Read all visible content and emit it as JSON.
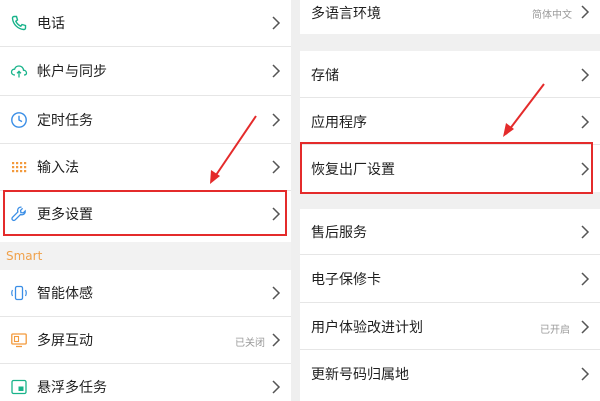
{
  "left_panel": {
    "items": [
      {
        "label": "电话",
        "icon": "phone-icon"
      },
      {
        "label": "帐户与同步",
        "icon": "cloud-sync-icon"
      },
      {
        "label": "定时任务",
        "icon": "clock-icon"
      },
      {
        "label": "输入法",
        "icon": "keyboard-icon"
      },
      {
        "label": "更多设置",
        "icon": "wrench-icon"
      }
    ],
    "smart_section_title": "Smart",
    "smart_items": [
      {
        "label": "智能体感",
        "icon": "phone-gesture-icon"
      },
      {
        "label": "多屏互动",
        "icon": "multi-screen-icon",
        "value": "已关闭"
      },
      {
        "label": "悬浮多任务",
        "icon": "floating-window-icon"
      }
    ]
  },
  "right_panel": {
    "items": [
      {
        "label": "多语言环境",
        "value": "简体中文"
      },
      {
        "label": "存储"
      },
      {
        "label": "应用程序"
      },
      {
        "label": "恢复出厂设置"
      },
      {
        "label": "售后服务"
      },
      {
        "label": "电子保修卡"
      },
      {
        "label": "用户体验改进计划",
        "value": "已开启"
      },
      {
        "label": "更新号码归属地"
      }
    ]
  },
  "colors": {
    "icon_accent": "#18b38a",
    "icon_blue": "#3a8ee6",
    "icon_orange": "#f39a3c",
    "smart_header_text": "#f0a14a",
    "highlight_red": "#e42b2b",
    "chevron": "#555555"
  }
}
